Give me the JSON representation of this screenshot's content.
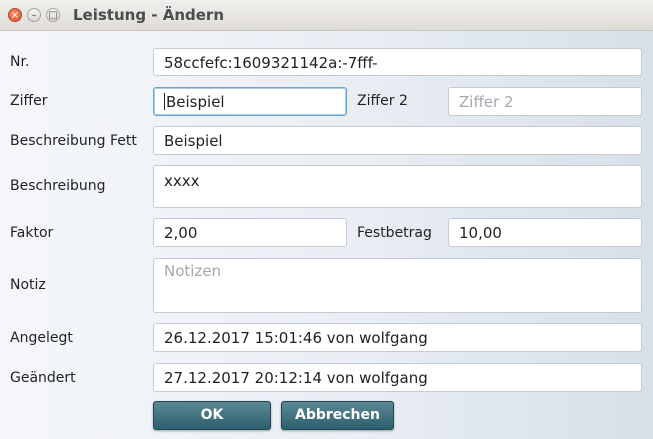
{
  "window": {
    "title": "Leistung - Ändern",
    "controls": {
      "close": "×",
      "minimize": "–",
      "maximize": "□"
    }
  },
  "form": {
    "nr": {
      "label": "Nr.",
      "value": "58ccfefc:1609321142a:-7fff-"
    },
    "ziffer": {
      "label": "Ziffer",
      "value": "Beispiel"
    },
    "ziffer2": {
      "label": "Ziffer 2",
      "placeholder": "Ziffer 2"
    },
    "beschreibung_fett": {
      "label": "Beschreibung Fett",
      "value": "Beispiel"
    },
    "beschreibung": {
      "label": "Beschreibung",
      "value": "xxxx"
    },
    "faktor": {
      "label": "Faktor",
      "value": "2,00"
    },
    "festbetrag": {
      "label": "Festbetrag",
      "value": "10,00"
    },
    "notiz": {
      "label": "Notiz",
      "placeholder": "Notizen"
    },
    "angelegt": {
      "label": "Angelegt",
      "value": "26.12.2017 15:01:46 von wolfgang"
    },
    "geaendert": {
      "label": "Geändert",
      "value": "27.12.2017 20:12:14 von wolfgang"
    }
  },
  "buttons": {
    "ok": "OK",
    "cancel": "Abbrechen"
  },
  "colors": {
    "accent": "#2d5f6d",
    "focus_border": "#6ba7d6",
    "close_button": "#e0542c"
  }
}
